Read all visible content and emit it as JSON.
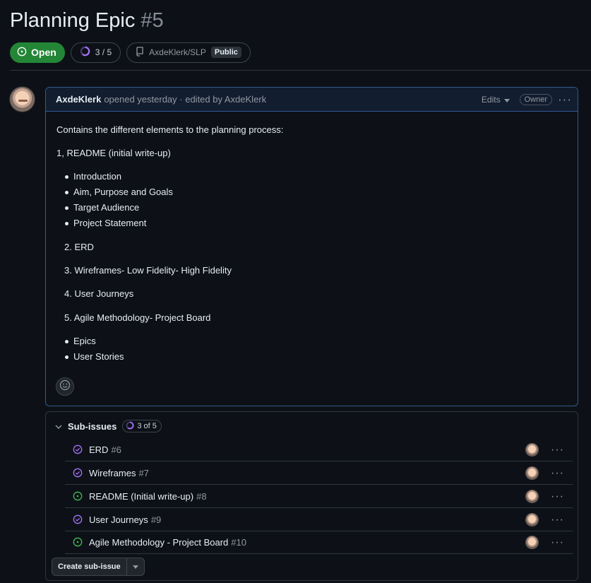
{
  "issue": {
    "title": "Planning Epic",
    "number": "#5",
    "state": "Open",
    "progress_text": "3 / 5",
    "progress_fraction": 0.6,
    "repo": "AxdeKlerk/SLP",
    "visibility": "Public"
  },
  "comment": {
    "author": "AxdeKlerk",
    "meta": "opened yesterday · edited by AxdeKlerk",
    "edits_label": "Edits",
    "owner_label": "Owner",
    "body": {
      "intro": "Contains the different elements to the planning process:",
      "item1": "1, README (initial write-up)",
      "bullets1": [
        "Introduction",
        "Aim, Purpose and Goals",
        "Target Audience",
        "Project Statement"
      ],
      "item2": "2. ERD",
      "item3": "3. Wireframes- Low Fidelity- High Fidelity",
      "item4": "4. User Journeys",
      "item5": "5. Agile Methodology- Project Board",
      "bullets2": [
        "Epics",
        "User Stories"
      ]
    }
  },
  "subissues": {
    "heading": "Sub-issues",
    "count_label": "3 of 5",
    "items": [
      {
        "title": "ERD",
        "number": "#6",
        "status": "closed"
      },
      {
        "title": "Wireframes",
        "number": "#7",
        "status": "closed"
      },
      {
        "title": "README (Initial write-up)",
        "number": "#8",
        "status": "open"
      },
      {
        "title": "User Journeys",
        "number": "#9",
        "status": "closed"
      },
      {
        "title": "Agile Methodology - Project Board",
        "number": "#10",
        "status": "open"
      }
    ],
    "create_label": "Create sub-issue"
  },
  "colors": {
    "open_green": "#3fb950",
    "closed_purple": "#a371f7",
    "accent_blue": "#305b8f"
  }
}
